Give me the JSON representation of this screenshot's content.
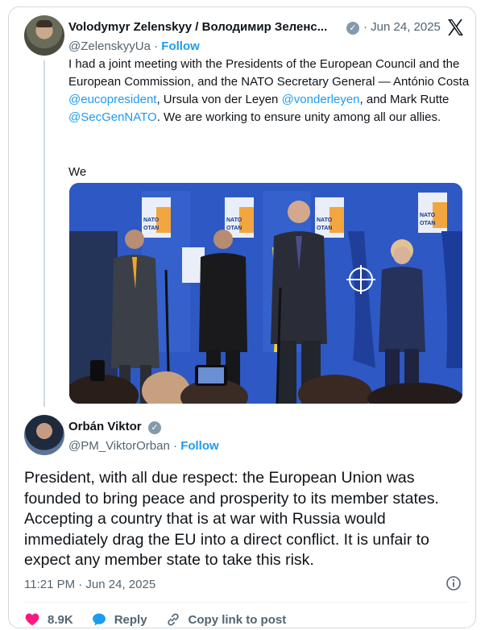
{
  "quoted_tweet": {
    "author_name": "Volodymyr Zelenskyy / Володимир Зеленс...",
    "date": "· Jun 24, 2025",
    "handle": "@ZelenskyyUa",
    "follow_label": "Follow",
    "text_parts": [
      "I had a joint meeting with the Presidents of the European Council and the European Commission, and the NATO Secretary General — António Costa ",
      "@eucopresident",
      ", Ursula von der Leyen ",
      "@vonderleyen",
      ", and Mark Rutte ",
      "@SecGenNATO",
      ". We are working to ensure unity among all our allies."
    ],
    "truncated_text": "We",
    "photo_signage": [
      "NATO",
      "OTAN",
      "NATO",
      "OTAN",
      "NATO",
      "OTAN",
      "NATO",
      "OTAN"
    ]
  },
  "main_tweet": {
    "author_name": "Orbán Viktor",
    "handle": "@PM_ViktorOrban",
    "follow_label": "Follow",
    "text": "President, with all due respect: the European Union was founded to bring peace and prosperity to its member states. Accepting a country that is at war with Russia would immediately drag the EU into a direct conflict. It is unfair to expect any member state to take this risk.",
    "timestamp": "11:21 PM · Jun 24, 2025"
  },
  "actions": {
    "likes": "8.9K",
    "reply_label": "Reply",
    "copy_link_label": "Copy link to post"
  },
  "colors": {
    "link_blue": "#1d9bf0",
    "like_red": "#f91880",
    "secondary_text": "#536471",
    "verified_gray": "#829aab"
  },
  "icons": [
    "x-logo-icon",
    "verified-badge-icon",
    "info-icon",
    "heart-icon",
    "reply-bubble-icon",
    "link-icon"
  ]
}
